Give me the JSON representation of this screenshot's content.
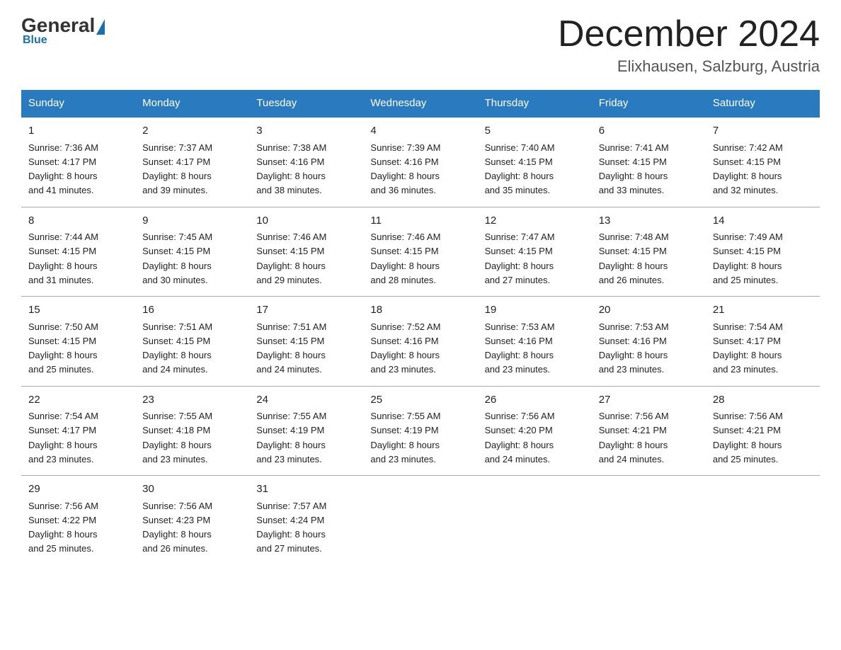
{
  "header": {
    "logo_general": "General",
    "logo_blue": "Blue",
    "main_title": "December 2024",
    "subtitle": "Elixhausen, Salzburg, Austria"
  },
  "columns": [
    "Sunday",
    "Monday",
    "Tuesday",
    "Wednesday",
    "Thursday",
    "Friday",
    "Saturday"
  ],
  "weeks": [
    [
      {
        "day": "1",
        "sunrise": "7:36 AM",
        "sunset": "4:17 PM",
        "daylight": "8 hours and 41 minutes."
      },
      {
        "day": "2",
        "sunrise": "7:37 AM",
        "sunset": "4:17 PM",
        "daylight": "8 hours and 39 minutes."
      },
      {
        "day": "3",
        "sunrise": "7:38 AM",
        "sunset": "4:16 PM",
        "daylight": "8 hours and 38 minutes."
      },
      {
        "day": "4",
        "sunrise": "7:39 AM",
        "sunset": "4:16 PM",
        "daylight": "8 hours and 36 minutes."
      },
      {
        "day": "5",
        "sunrise": "7:40 AM",
        "sunset": "4:15 PM",
        "daylight": "8 hours and 35 minutes."
      },
      {
        "day": "6",
        "sunrise": "7:41 AM",
        "sunset": "4:15 PM",
        "daylight": "8 hours and 33 minutes."
      },
      {
        "day": "7",
        "sunrise": "7:42 AM",
        "sunset": "4:15 PM",
        "daylight": "8 hours and 32 minutes."
      }
    ],
    [
      {
        "day": "8",
        "sunrise": "7:44 AM",
        "sunset": "4:15 PM",
        "daylight": "8 hours and 31 minutes."
      },
      {
        "day": "9",
        "sunrise": "7:45 AM",
        "sunset": "4:15 PM",
        "daylight": "8 hours and 30 minutes."
      },
      {
        "day": "10",
        "sunrise": "7:46 AM",
        "sunset": "4:15 PM",
        "daylight": "8 hours and 29 minutes."
      },
      {
        "day": "11",
        "sunrise": "7:46 AM",
        "sunset": "4:15 PM",
        "daylight": "8 hours and 28 minutes."
      },
      {
        "day": "12",
        "sunrise": "7:47 AM",
        "sunset": "4:15 PM",
        "daylight": "8 hours and 27 minutes."
      },
      {
        "day": "13",
        "sunrise": "7:48 AM",
        "sunset": "4:15 PM",
        "daylight": "8 hours and 26 minutes."
      },
      {
        "day": "14",
        "sunrise": "7:49 AM",
        "sunset": "4:15 PM",
        "daylight": "8 hours and 25 minutes."
      }
    ],
    [
      {
        "day": "15",
        "sunrise": "7:50 AM",
        "sunset": "4:15 PM",
        "daylight": "8 hours and 25 minutes."
      },
      {
        "day": "16",
        "sunrise": "7:51 AM",
        "sunset": "4:15 PM",
        "daylight": "8 hours and 24 minutes."
      },
      {
        "day": "17",
        "sunrise": "7:51 AM",
        "sunset": "4:15 PM",
        "daylight": "8 hours and 24 minutes."
      },
      {
        "day": "18",
        "sunrise": "7:52 AM",
        "sunset": "4:16 PM",
        "daylight": "8 hours and 23 minutes."
      },
      {
        "day": "19",
        "sunrise": "7:53 AM",
        "sunset": "4:16 PM",
        "daylight": "8 hours and 23 minutes."
      },
      {
        "day": "20",
        "sunrise": "7:53 AM",
        "sunset": "4:16 PM",
        "daylight": "8 hours and 23 minutes."
      },
      {
        "day": "21",
        "sunrise": "7:54 AM",
        "sunset": "4:17 PM",
        "daylight": "8 hours and 23 minutes."
      }
    ],
    [
      {
        "day": "22",
        "sunrise": "7:54 AM",
        "sunset": "4:17 PM",
        "daylight": "8 hours and 23 minutes."
      },
      {
        "day": "23",
        "sunrise": "7:55 AM",
        "sunset": "4:18 PM",
        "daylight": "8 hours and 23 minutes."
      },
      {
        "day": "24",
        "sunrise": "7:55 AM",
        "sunset": "4:19 PM",
        "daylight": "8 hours and 23 minutes."
      },
      {
        "day": "25",
        "sunrise": "7:55 AM",
        "sunset": "4:19 PM",
        "daylight": "8 hours and 23 minutes."
      },
      {
        "day": "26",
        "sunrise": "7:56 AM",
        "sunset": "4:20 PM",
        "daylight": "8 hours and 24 minutes."
      },
      {
        "day": "27",
        "sunrise": "7:56 AM",
        "sunset": "4:21 PM",
        "daylight": "8 hours and 24 minutes."
      },
      {
        "day": "28",
        "sunrise": "7:56 AM",
        "sunset": "4:21 PM",
        "daylight": "8 hours and 25 minutes."
      }
    ],
    [
      {
        "day": "29",
        "sunrise": "7:56 AM",
        "sunset": "4:22 PM",
        "daylight": "8 hours and 25 minutes."
      },
      {
        "day": "30",
        "sunrise": "7:56 AM",
        "sunset": "4:23 PM",
        "daylight": "8 hours and 26 minutes."
      },
      {
        "day": "31",
        "sunrise": "7:57 AM",
        "sunset": "4:24 PM",
        "daylight": "8 hours and 27 minutes."
      },
      null,
      null,
      null,
      null
    ]
  ],
  "labels": {
    "sunrise": "Sunrise:",
    "sunset": "Sunset:",
    "daylight": "Daylight:"
  }
}
